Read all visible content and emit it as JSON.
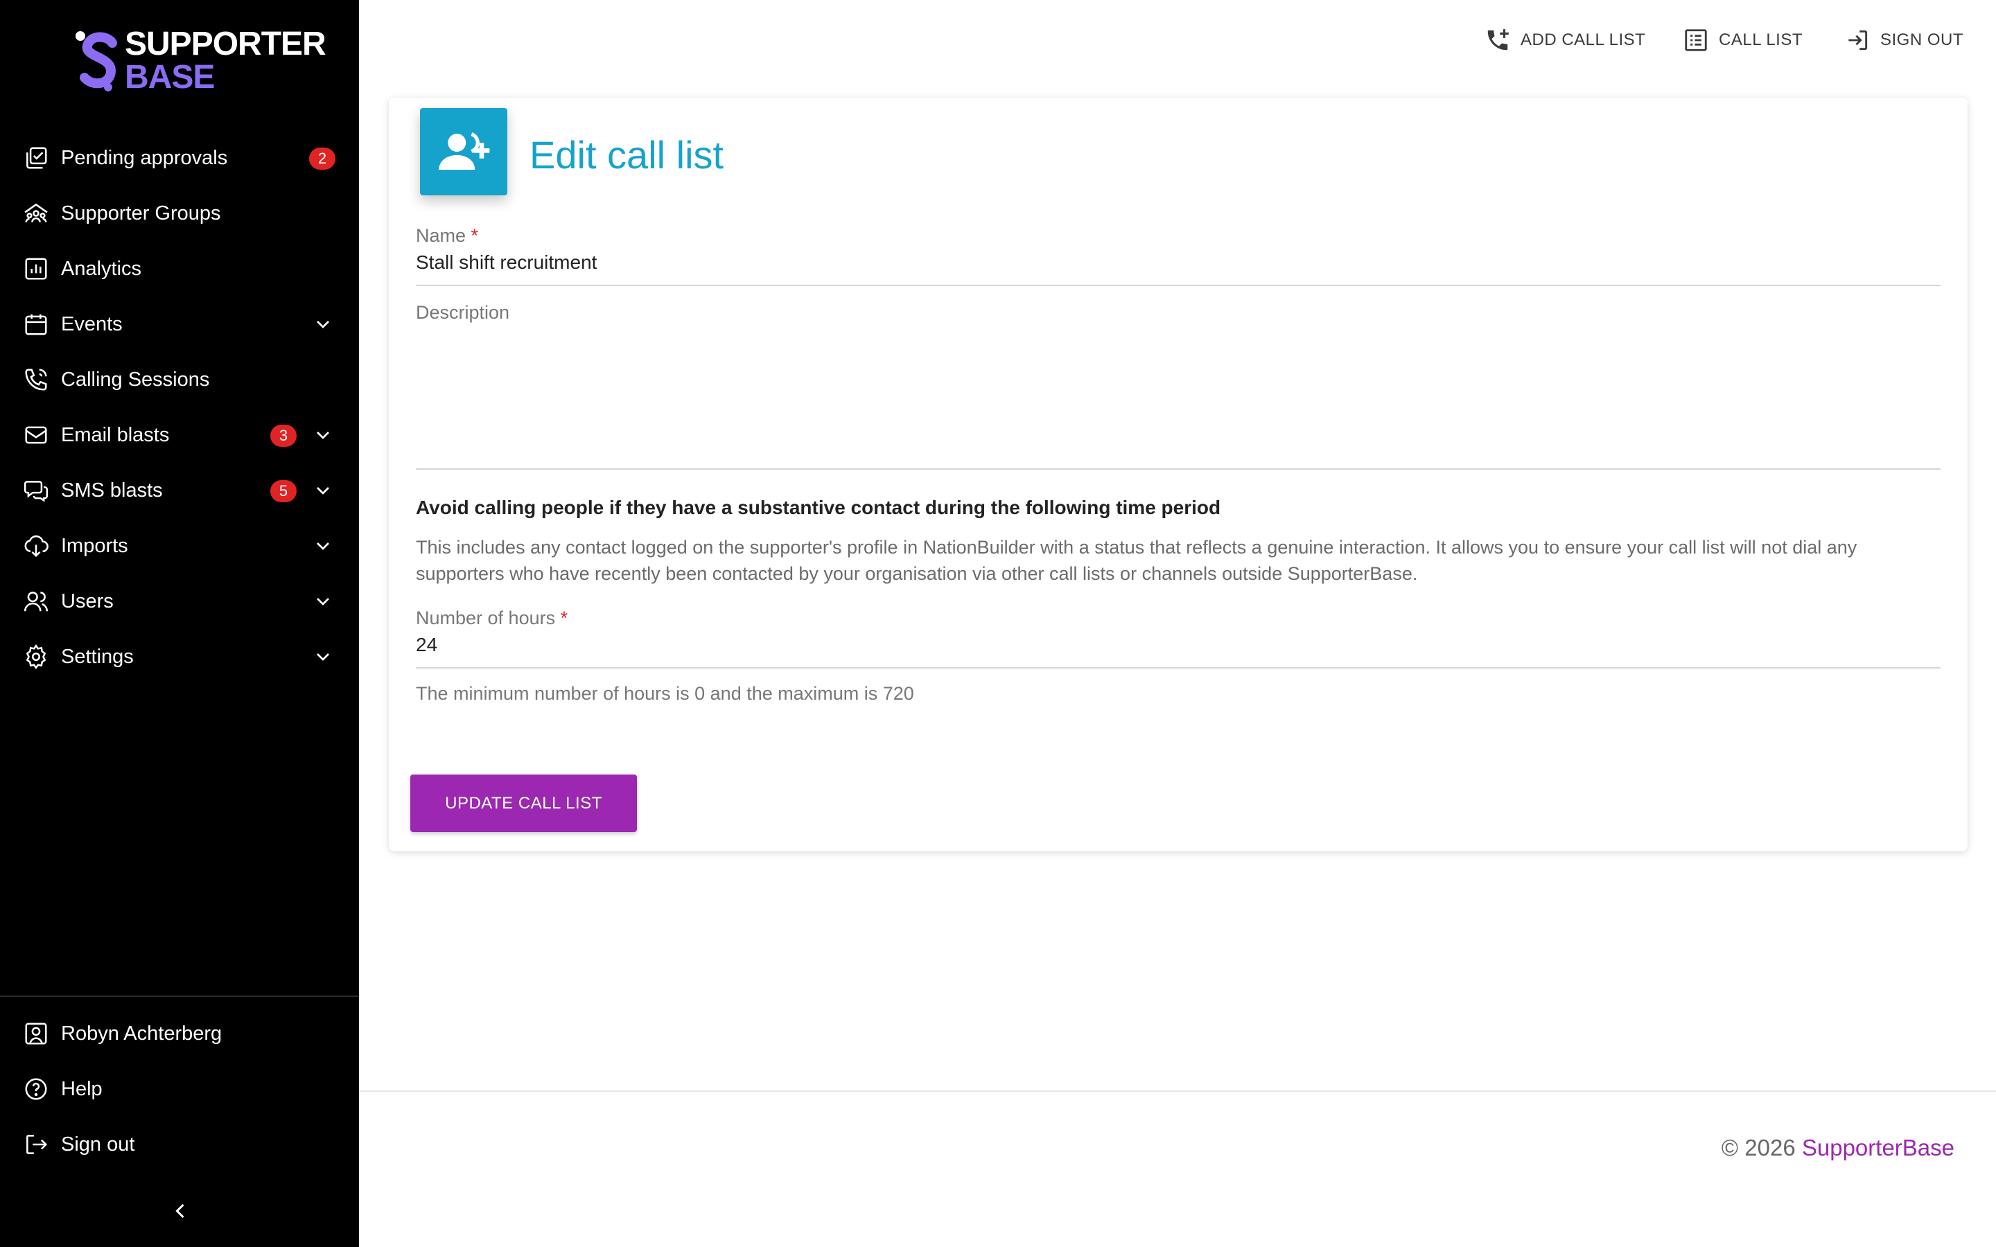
{
  "brand": {
    "line1": "SUPPORTER",
    "line2": "BASE",
    "accent_color": "#8b6cf2"
  },
  "sidebar": {
    "items": [
      {
        "label": "Pending approvals",
        "icon": "approvals-icon",
        "badge": "2",
        "expandable": false
      },
      {
        "label": "Supporter Groups",
        "icon": "groups-icon",
        "badge": null,
        "expandable": false
      },
      {
        "label": "Analytics",
        "icon": "analytics-icon",
        "badge": null,
        "expandable": false
      },
      {
        "label": "Events",
        "icon": "calendar-icon",
        "badge": null,
        "expandable": true
      },
      {
        "label": "Calling Sessions",
        "icon": "phone-icon",
        "badge": null,
        "expandable": false
      },
      {
        "label": "Email blasts",
        "icon": "mail-icon",
        "badge": "3",
        "expandable": true
      },
      {
        "label": "SMS blasts",
        "icon": "chat-icon",
        "badge": "5",
        "expandable": true
      },
      {
        "label": "Imports",
        "icon": "import-icon",
        "badge": null,
        "expandable": true
      },
      {
        "label": "Users",
        "icon": "users-icon",
        "badge": null,
        "expandable": true
      },
      {
        "label": "Settings",
        "icon": "gear-icon",
        "badge": null,
        "expandable": true
      }
    ],
    "bottom": [
      {
        "label": "Robyn Achterberg",
        "icon": "user-profile-icon"
      },
      {
        "label": "Help",
        "icon": "help-icon"
      },
      {
        "label": "Sign out",
        "icon": "sign-out-icon"
      }
    ],
    "collapse_icon": "chevron-left-icon"
  },
  "topbar": {
    "add_call_list": "ADD CALL LIST",
    "call_list": "CALL LIST",
    "sign_out": "SIGN OUT"
  },
  "form": {
    "title": "Edit call list",
    "name_label": "Name",
    "name_value": "Stall shift recruitment",
    "required_mark": "*",
    "description_label": "Description",
    "description_value": "",
    "section_title": "Avoid calling people if they have a substantive contact during the following time period",
    "section_desc": "This includes any contact logged on the supporter's profile in NationBuilder with a status that reflects a genuine interaction. It allows you to ensure your call list will not dial any supporters who have recently been contacted by your organisation via other call lists or channels outside SupporterBase.",
    "hours_label": "Number of hours",
    "hours_value": "24",
    "hours_hint": "The minimum number of hours is 0 and the maximum is 720",
    "submit_label": "UPDATE CALL LIST"
  },
  "footer": {
    "copyright": "© 2026",
    "link": "SupporterBase"
  },
  "colors": {
    "sidebar_bg": "#000000",
    "title_color": "#16a3cb",
    "primary_button": "#9c27b0",
    "badge_red": "#e02424"
  }
}
